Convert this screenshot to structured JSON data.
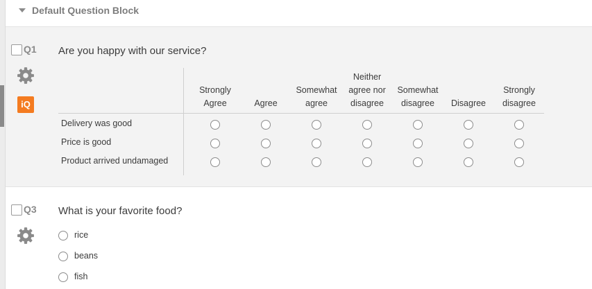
{
  "block": {
    "title": "Default Question Block"
  },
  "q1": {
    "id": "Q1",
    "text": "Are you happy with our service?",
    "iq_label": "iQ",
    "columns": [
      {
        "line1": "",
        "line2": "Strongly",
        "line3": "Agree"
      },
      {
        "line1": "",
        "line2": "",
        "line3": "Agree"
      },
      {
        "line1": "",
        "line2": "Somewhat",
        "line3": "agree"
      },
      {
        "line1": "Neither",
        "line2": "agree nor",
        "line3": "disagree"
      },
      {
        "line1": "",
        "line2": "Somewhat",
        "line3": "disagree"
      },
      {
        "line1": "",
        "line2": "",
        "line3": "Disagree"
      },
      {
        "line1": "",
        "line2": "Strongly",
        "line3": "disagree"
      }
    ],
    "rows": [
      "Delivery was good",
      "Price is good",
      "Product arrived undamaged"
    ]
  },
  "q3": {
    "id": "Q3",
    "text": "What is your favorite food?",
    "choices": [
      "rice",
      "beans",
      "fish"
    ]
  },
  "icons": {
    "gear": "gear-icon",
    "caret": "caret-down-icon",
    "iq": "iq-icon"
  },
  "colors": {
    "accent": "#f47b20",
    "question_bg": "#f3f3f3",
    "muted_text": "#8a8a8a"
  }
}
